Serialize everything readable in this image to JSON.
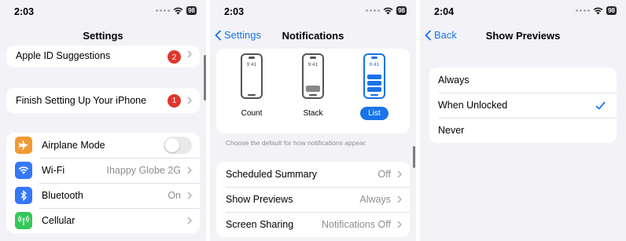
{
  "colors": {
    "accent": "#1a73e8",
    "badge": "#e0362b",
    "airplane": "#f09a37",
    "wifi": "#3478f6",
    "bluetooth": "#3478f6",
    "cellular": "#34c759"
  },
  "status": {
    "battery": "98"
  },
  "settings": {
    "time": "2:03",
    "title": "Settings",
    "suggestions": {
      "label": "Apple ID Suggestions",
      "badge": "2"
    },
    "finish_setup": {
      "label": "Finish Setting Up Your iPhone",
      "badge": "1"
    },
    "airplane": {
      "label": "Airplane Mode",
      "icon": "airplane-icon",
      "toggle_on": false
    },
    "wifi": {
      "label": "Wi-Fi",
      "value": "Ihappy Globe 2G",
      "icon": "wifi-icon"
    },
    "bluetooth": {
      "label": "Bluetooth",
      "value": "On",
      "icon": "bluetooth-icon"
    },
    "cellular": {
      "label": "Cellular",
      "icon": "cellular-antenna-icon"
    }
  },
  "notifications": {
    "time": "2:03",
    "back_label": "Settings",
    "title": "Notifications",
    "style_options": [
      {
        "label": "Count",
        "time": "9:41",
        "selected": false
      },
      {
        "label": "Stack",
        "time": "9:41",
        "selected": false
      },
      {
        "label": "List",
        "time": "9:41",
        "selected": true
      }
    ],
    "footnote": "Choose the default for how notifications appear.",
    "rows": [
      {
        "label": "Scheduled Summary",
        "value": "Off"
      },
      {
        "label": "Show Previews",
        "value": "Always"
      },
      {
        "label": "Screen Sharing",
        "value": "Notifications Off"
      }
    ]
  },
  "previews": {
    "time": "2:04",
    "back_label": "Back",
    "title": "Show Previews",
    "options": [
      {
        "label": "Always",
        "selected": false
      },
      {
        "label": "When Unlocked",
        "selected": true
      },
      {
        "label": "Never",
        "selected": false
      }
    ]
  }
}
